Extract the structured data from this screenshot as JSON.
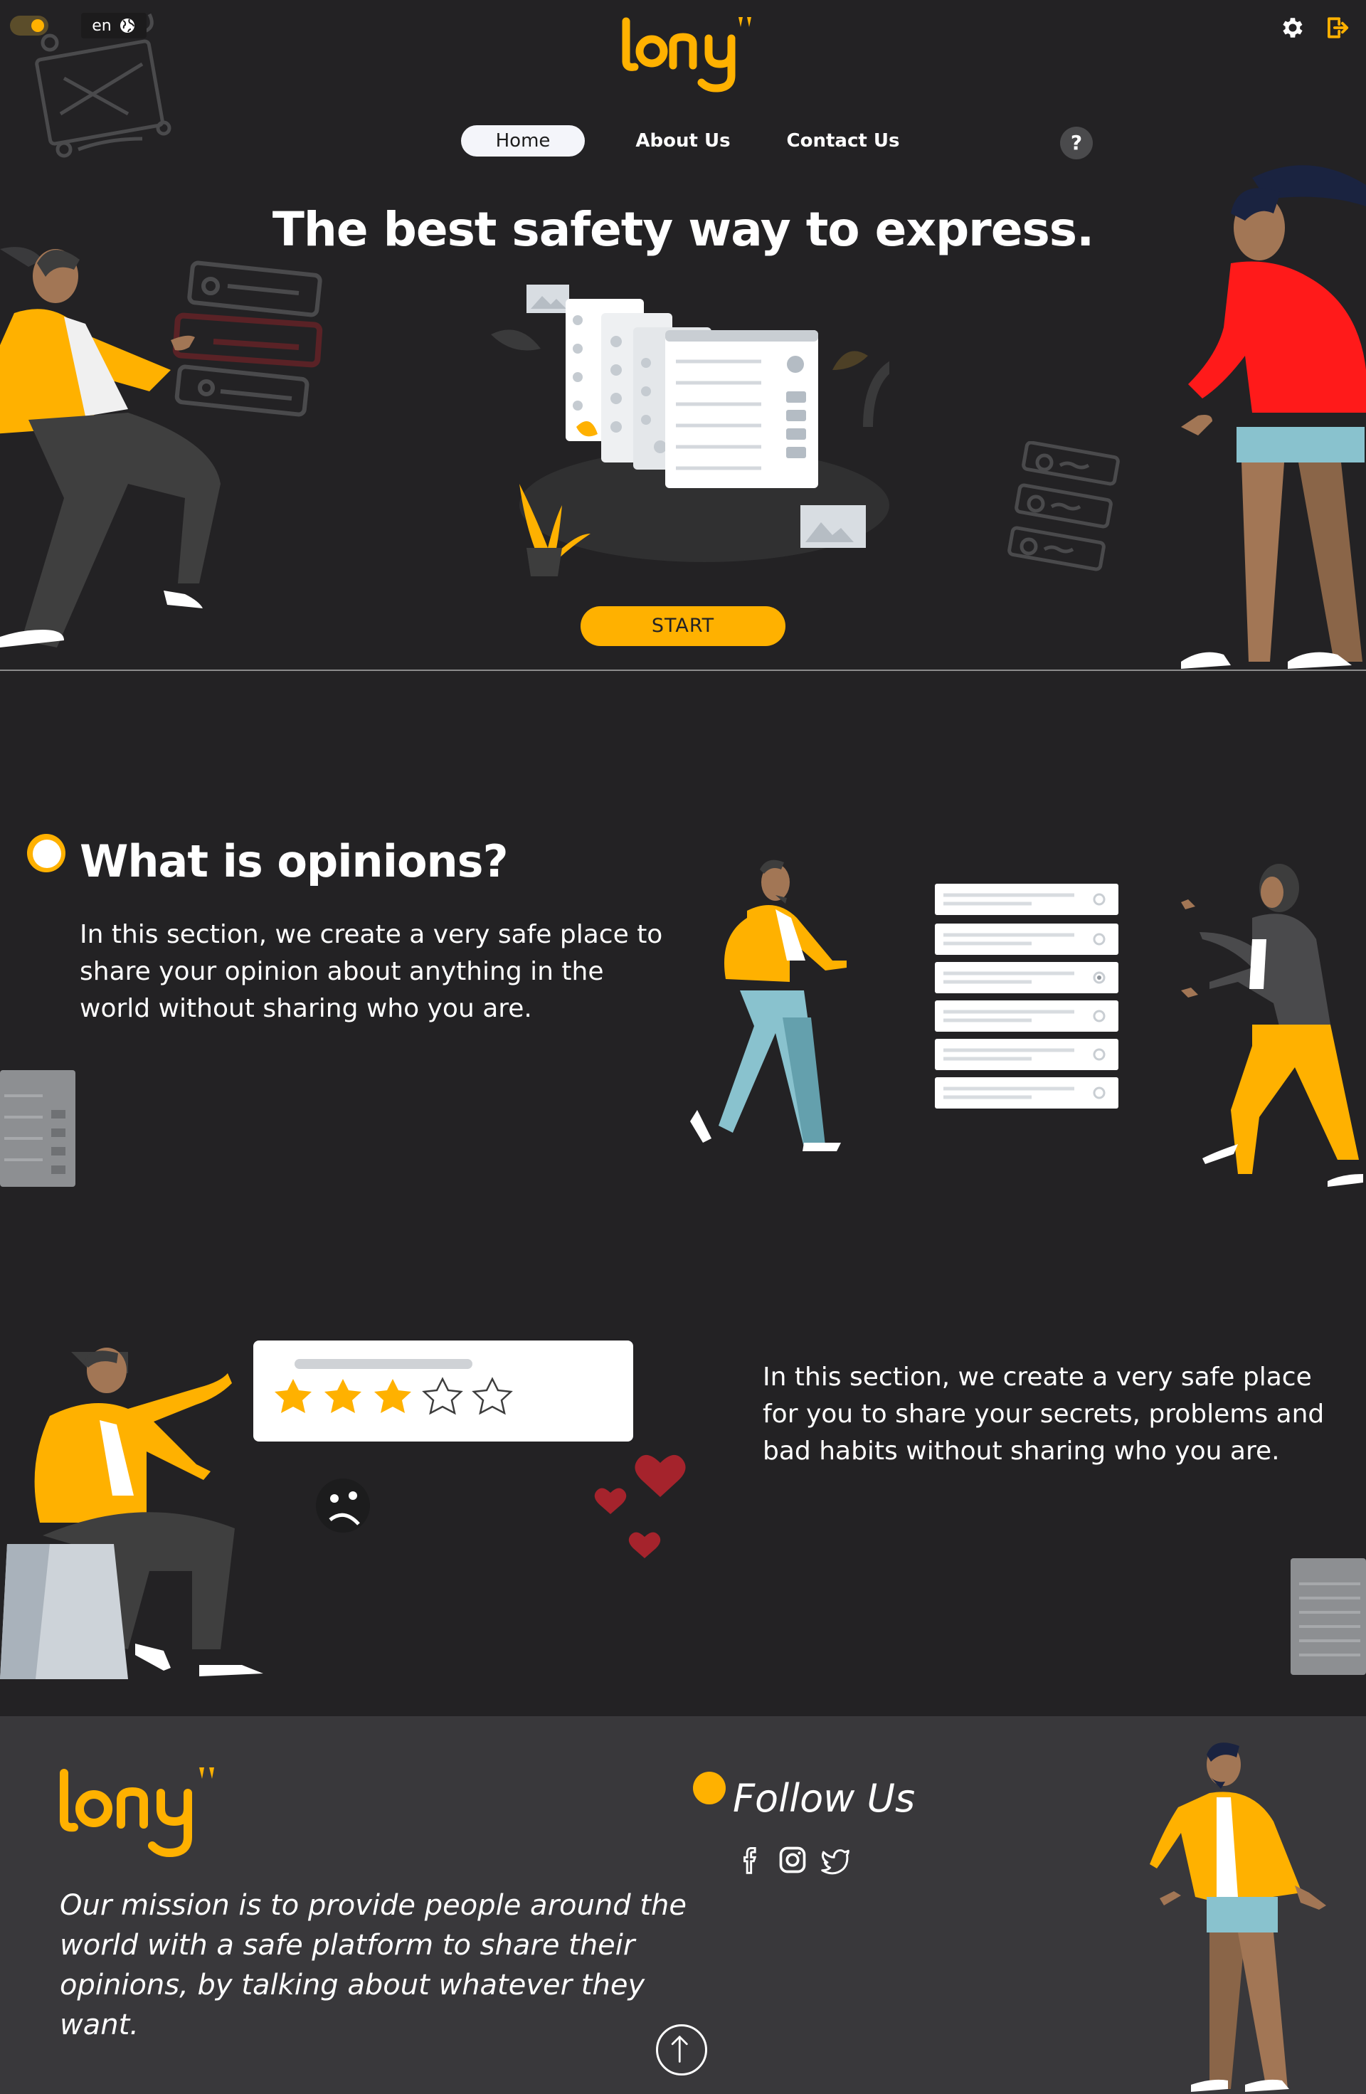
{
  "header": {
    "lang_label": "en",
    "logo_text": "lony",
    "icons": [
      "theme-toggle-icon",
      "globe-icon",
      "gear-icon",
      "logout-icon",
      "help-icon"
    ]
  },
  "nav": {
    "home": "Home",
    "about": "About Us",
    "contact": "Contact Us",
    "help": "?"
  },
  "hero": {
    "title": "The best safety way to express.",
    "start_label": "START"
  },
  "section_opinions": {
    "title": "What is opinions?",
    "text": "In this section, we create a very safe place to share your opinion about anything in the world without sharing who you are."
  },
  "section_secrets": {
    "text": "In this section, we create a very safe place for you to share your secrets, problems and bad habits without sharing who you are.",
    "rating_stars": 3,
    "rating_max": 5
  },
  "footer": {
    "logo_text": "lony",
    "mission": "Our mission is to provide people around the world with a safe platform to share their opinions, by talking about whatever they want.",
    "follow_title": "Follow Us",
    "social_icons": [
      "facebook-icon",
      "instagram-icon",
      "twitter-icon"
    ]
  },
  "colors": {
    "background": "#232224",
    "accent": "#ffb100",
    "footer": "#39383b",
    "heart": "#a5232c",
    "jacket_red": "#ff1a1a"
  }
}
